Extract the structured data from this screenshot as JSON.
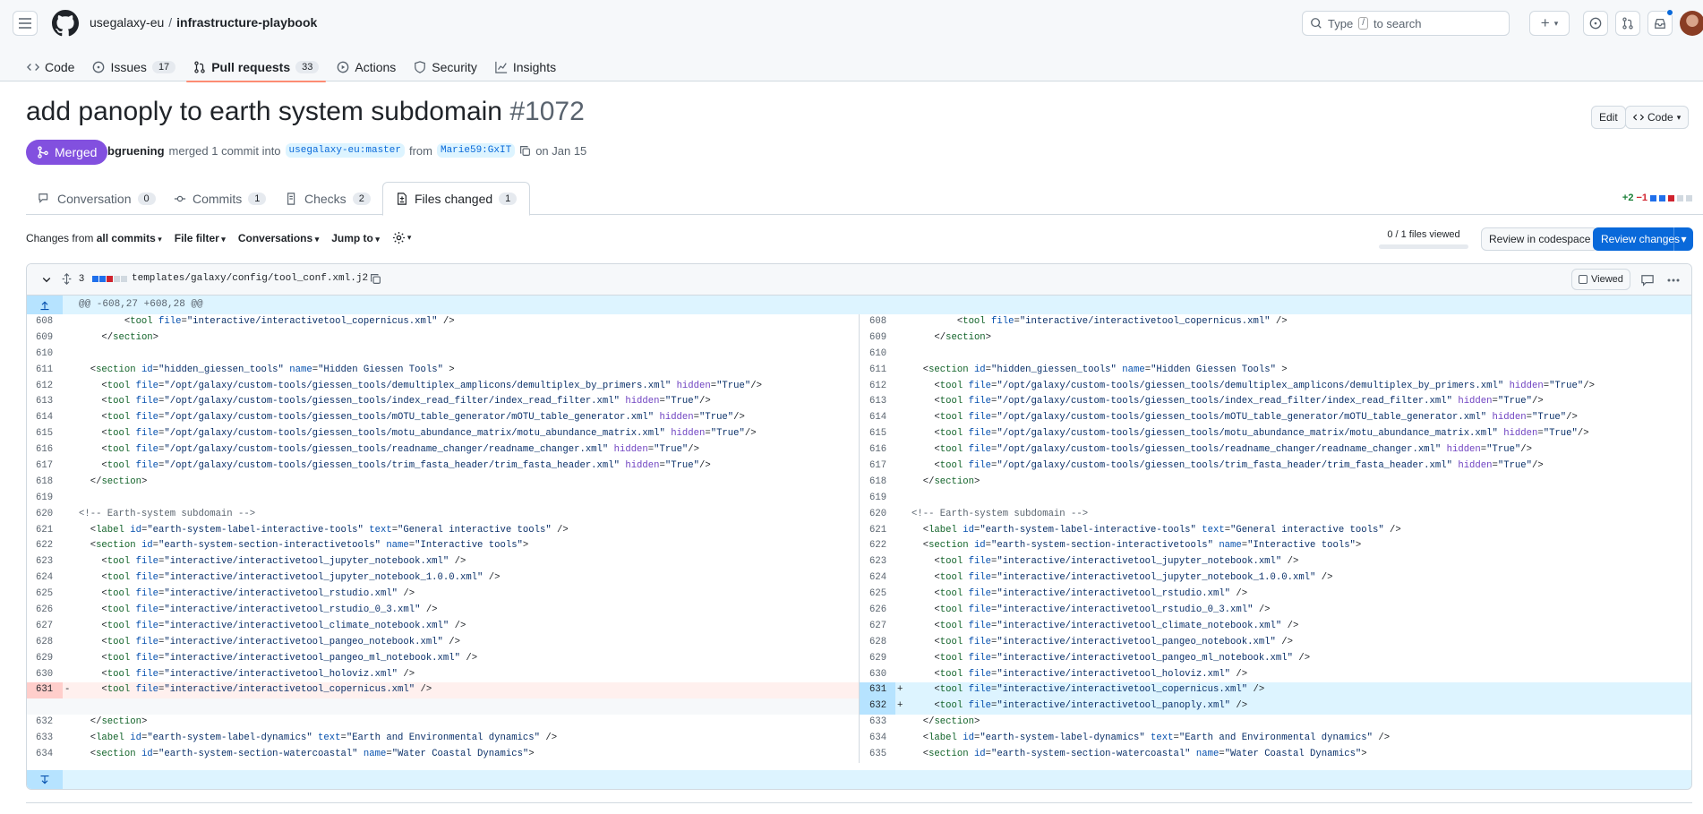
{
  "header": {
    "owner": "usegalaxy-eu",
    "separator": "/",
    "repo": "infrastructure-playbook",
    "search_pre": "Type",
    "search_key": "/",
    "search_post": "to search",
    "new_label": "+"
  },
  "repo_nav": [
    {
      "label": "Code",
      "count": "",
      "icon": "code-icon"
    },
    {
      "label": "Issues",
      "count": "17",
      "icon": "issue-opened-icon"
    },
    {
      "label": "Pull requests",
      "count": "33",
      "icon": "git-pull-request-icon"
    },
    {
      "label": "Actions",
      "count": "",
      "icon": "play-icon"
    },
    {
      "label": "Security",
      "count": "",
      "icon": "shield-icon"
    },
    {
      "label": "Insights",
      "count": "",
      "icon": "graph-icon"
    }
  ],
  "pr": {
    "title": "add panoply to earth system subdomain",
    "number": "#1072",
    "status": "Merged",
    "author": "bgruening",
    "action": "merged 1 commit into",
    "base": "usegalaxy-eu:master",
    "from_word": "from",
    "head": "Marie59:GxIT",
    "date": "on Jan 15",
    "edit_label": "Edit",
    "code_label": "Code"
  },
  "pr_tabs": [
    {
      "label": "Conversation",
      "count": "0"
    },
    {
      "label": "Commits",
      "count": "1"
    },
    {
      "label": "Checks",
      "count": "2"
    },
    {
      "label": "Files changed",
      "count": "1"
    }
  ],
  "diffstat": {
    "additions": "+2",
    "deletions": "−1"
  },
  "toolbar": {
    "changes_from_pre": "Changes from",
    "changes_from_value": "all commits",
    "file_filter": "File filter",
    "conversations": "Conversations",
    "jump_to": "Jump to",
    "files_viewed": "0 / 1 files viewed",
    "review_codespace": "Review in codespace",
    "review_changes": "Review changes"
  },
  "file": {
    "changes": "3",
    "path": "templates/galaxy/config/tool_conf.xml.j2",
    "viewed_label": "Viewed",
    "hunk_header": "@@ -608,27 +608,28 @@"
  },
  "colors": {
    "merged": "#8250df",
    "primary": "#0969da",
    "deleted": "#ffcecb",
    "added": "#b6e3ff"
  }
}
